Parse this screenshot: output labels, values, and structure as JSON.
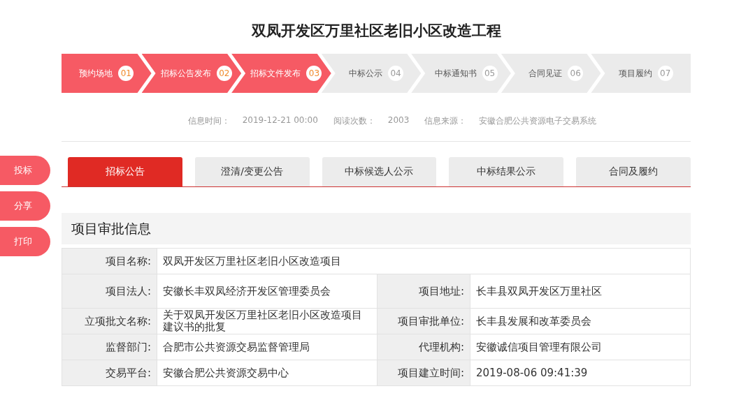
{
  "title": "双凤开发区万里社区老旧小区改造工程",
  "steps": [
    {
      "label": "预约场地",
      "number": "01",
      "done": true
    },
    {
      "label": "招标公告发布",
      "number": "02",
      "done": true
    },
    {
      "label": "招标文件发布",
      "number": "03",
      "done": true
    },
    {
      "label": "中标公示",
      "number": "04",
      "done": false
    },
    {
      "label": "中标通知书",
      "number": "05",
      "done": false
    },
    {
      "label": "合同见证",
      "number": "06",
      "done": false
    },
    {
      "label": "项目履约",
      "number": "07",
      "done": false
    }
  ],
  "meta": [
    {
      "label": "信息时间：",
      "value": "2019-12-21 00:00"
    },
    {
      "label": "阅读次数：",
      "value": "2003"
    },
    {
      "label": "信息来源：",
      "value": "安徽合肥公共资源电子交易系统"
    }
  ],
  "side_buttons": [
    "投标",
    "分享",
    "打印"
  ],
  "tabs": [
    {
      "label": "招标公告",
      "selected": true
    },
    {
      "label": "澄清/变更公告",
      "selected": false
    },
    {
      "label": "中标候选人公示",
      "selected": false
    },
    {
      "label": "中标结果公示",
      "selected": false
    },
    {
      "label": "合同及履约",
      "selected": false
    }
  ],
  "section_title": "项目审批信息",
  "table_rows": [
    [
      {
        "label": "项目名称:",
        "value": "双凤开发区万里社区老旧小区改造项目"
      }
    ],
    [
      {
        "label": "项目法人:",
        "value": "安徽长丰双凤经济开发区管理委员会"
      },
      {
        "label": "项目地址:",
        "value": "长丰县双凤开发区万里社区"
      }
    ],
    [
      {
        "label": "立项批文名称:",
        "value": "关于双凤开发区万里社区老旧小区改造项目建议书的批复"
      },
      {
        "label": "项目审批单位:",
        "value": "长丰县发展和改革委员会"
      }
    ],
    [
      {
        "label": "监督部门:",
        "value": "合肥市公共资源交易监督管理局"
      },
      {
        "label": "代理机构:",
        "value": "安徽诚信项目管理有限公司"
      }
    ],
    [
      {
        "label": "交易平台:",
        "value": "安徽合肥公共资源交易中心"
      },
      {
        "label": "项目建立时间:",
        "value": "2019-08-06 09:41:39"
      }
    ]
  ]
}
